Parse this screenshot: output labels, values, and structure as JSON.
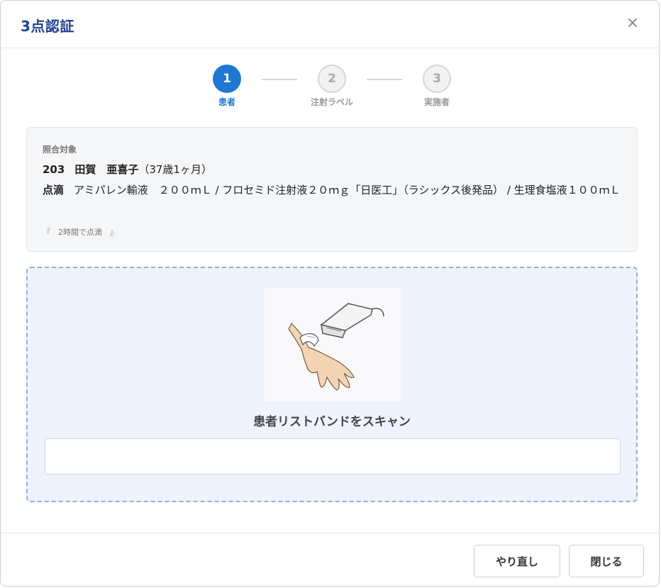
{
  "dialog": {
    "title": "3点認証",
    "close_symbol": "×"
  },
  "stepper": {
    "steps": [
      {
        "number": "1",
        "label": "患者",
        "state": "active"
      },
      {
        "number": "2",
        "label": "注射ラベル",
        "state": "inactive"
      },
      {
        "number": "3",
        "label": "実施者",
        "state": "inactive"
      }
    ]
  },
  "target": {
    "section_label": "照合対象",
    "room": "203",
    "name": "田賀　亜喜子",
    "age": "（37歳1ヶ月）",
    "order_type": "点滴",
    "order_text": "アミパレン輸液　２００ｍＬ / フロセミド注射液２０ｍｇ「日医工」（ラシックス後発品） / 生理食塩液１００ｍＬ",
    "note": "『　2時間で点滴　』"
  },
  "scan": {
    "instruction": "患者リストバンドをスキャン",
    "input_value": "",
    "input_placeholder": ""
  },
  "footer": {
    "redo_label": "やり直し",
    "close_label": "閉じる"
  },
  "colors": {
    "primary": "#1e78d2",
    "title": "#1f3f8f",
    "scan_bg": "#eef3fd",
    "scan_border": "#8fb0dd"
  }
}
